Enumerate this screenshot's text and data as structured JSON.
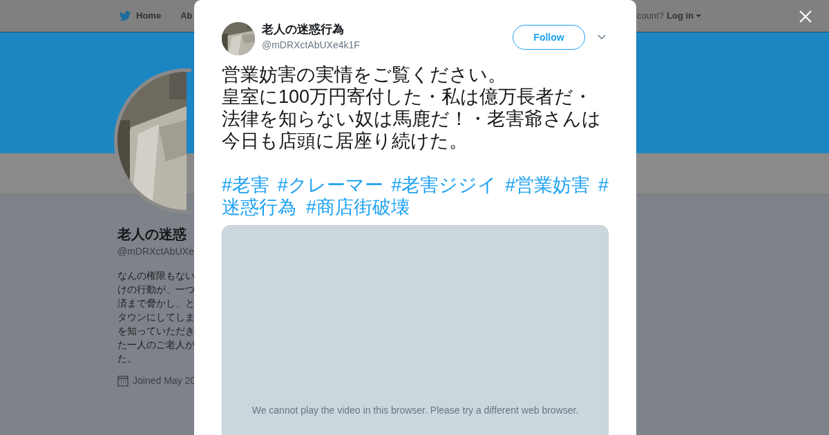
{
  "nav": {
    "home": "Home",
    "about": "Ab",
    "account_prompt": "count?",
    "login": "Log in"
  },
  "profile": {
    "name": "老人の迷惑",
    "handle": "@mDRXctAbUXe",
    "bio_lines": [
      "なんの権限もない",
      "けの行動が、一つ",
      "済まで脅かし、と",
      "タウンにしてしま",
      "を知っていただき",
      "た一人のご老人が",
      "た。"
    ],
    "joined": "Joined May 20"
  },
  "tweet": {
    "name": "老人の迷惑行為",
    "handle": "@mDRXctAbUXe4k1F",
    "follow": "Follow",
    "text_lines": [
      "営業妨害の実情をご覧ください。",
      "皇室に100万円寄付した・私は億万長者だ・",
      "法律を知らない奴は馬鹿だ！・老害爺さんは",
      "今日も店頭に居座り続けた。"
    ],
    "hashtag_lines": [
      [
        "#老害",
        "#クレーマー",
        "#老害ジジイ",
        "#営業妨害",
        "#"
      ],
      [
        "迷惑行為",
        "#商店街破壊"
      ]
    ],
    "video_message": "We cannot play the video in this browser. Please try a different web browser."
  }
}
